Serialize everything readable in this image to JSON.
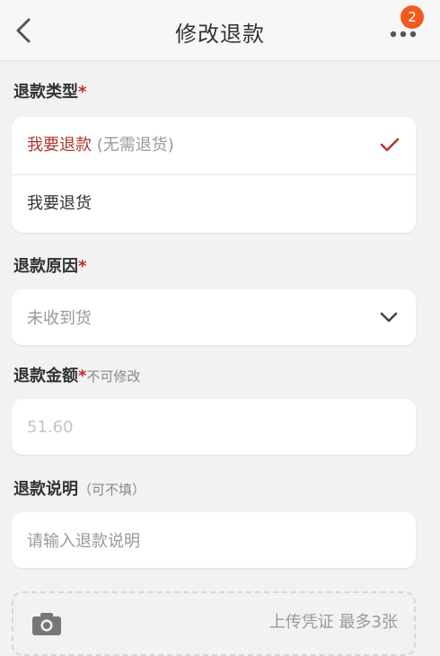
{
  "header": {
    "title": "修改退款",
    "badge_count": "2"
  },
  "refund_type": {
    "label": "退款类型",
    "required_mark": "*",
    "options": [
      {
        "label": "我要退款",
        "sub": " (无需退货)",
        "selected": true
      },
      {
        "label": "我要退货",
        "sub": "",
        "selected": false
      }
    ]
  },
  "refund_reason": {
    "label": "退款原因",
    "required_mark": "*",
    "value": "未收到货"
  },
  "refund_amount": {
    "label": "退款金额",
    "required_mark": "*",
    "hint": "不可修改",
    "value": "51.60"
  },
  "refund_note": {
    "label": "退款说明",
    "hint": "（可不填）",
    "placeholder": "请输入退款说明"
  },
  "upload": {
    "label": "上传凭证 最多3张"
  },
  "colors": {
    "accent": "#b0352f",
    "required": "#c8242c",
    "badge": "#f25a1d",
    "background": "#f2f2f2"
  },
  "icons": [
    "back-arrow-icon",
    "more-dots-icon",
    "check-icon",
    "chevron-down-icon",
    "camera-icon"
  ]
}
